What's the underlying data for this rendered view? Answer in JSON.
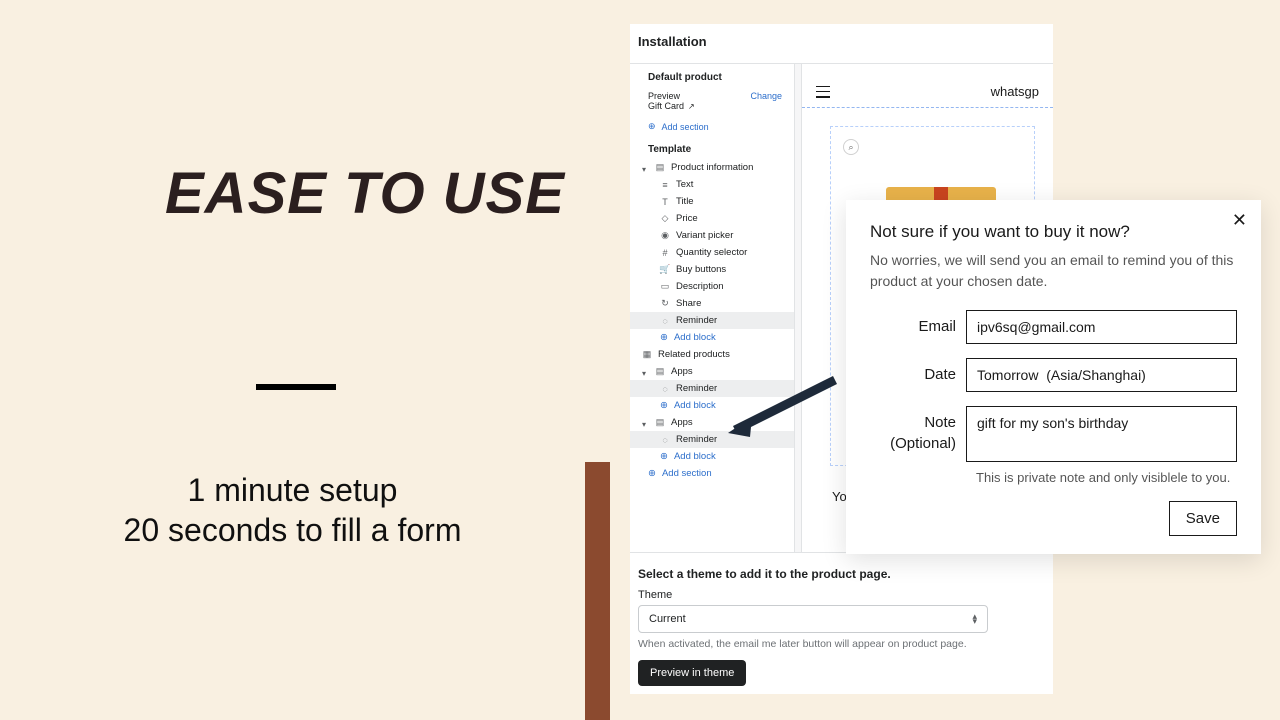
{
  "headline": "EASE TO USE",
  "subtext_line1": "1 minute setup",
  "subtext_line2": "20 seconds to fill a form",
  "editor": {
    "block_title": "Installation",
    "default_product": "Default product",
    "preview_label": "Preview",
    "change_label": "Change",
    "gift_card": "Gift Card",
    "add_section": "Add section",
    "template_label": "Template",
    "items": {
      "product_info": "Product information",
      "text": "Text",
      "title": "Title",
      "price": "Price",
      "variant_picker": "Variant picker",
      "quantity_selector": "Quantity selector",
      "buy_buttons": "Buy buttons",
      "description": "Description",
      "share": "Share",
      "reminder": "Reminder",
      "add_block": "Add block",
      "related_products": "Related products",
      "apps": "Apps"
    }
  },
  "preview": {
    "brand": "whatsgp",
    "yo_fragment": "Yo"
  },
  "theme_section": {
    "instruction": "Select a theme to add it to the product page.",
    "label": "Theme",
    "value": "Current",
    "hint": "When activated, the email me later button will appear on product page.",
    "preview_btn": "Preview in theme"
  },
  "modal": {
    "title": "Not sure if you want to buy it now?",
    "subtitle": "No worries, we will send you an email to remind you of this product at your chosen date.",
    "email_label": "Email",
    "email_value": "ipv6sq@gmail.com",
    "date_label": "Date",
    "date_value": "Tomorrow  (Asia/Shanghai)",
    "note_label_line1": "Note",
    "note_label_line2": "(Optional)",
    "note_value": "gift for my son's birthday",
    "note_hint": "This is private note and only visiblele to you.",
    "save": "Save"
  }
}
